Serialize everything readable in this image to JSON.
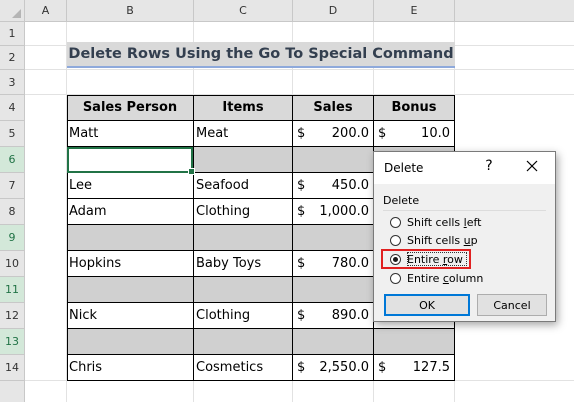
{
  "columns": [
    "A",
    "B",
    "C",
    "D",
    "E"
  ],
  "rows": [
    "1",
    "2",
    "3",
    "4",
    "5",
    "6",
    "7",
    "8",
    "9",
    "10",
    "11",
    "12",
    "13",
    "14"
  ],
  "title": "Delete Rows Using the Go To Special Command",
  "table": {
    "headers": [
      "Sales Person",
      "Items",
      "Sales",
      "Bonus"
    ],
    "rows": [
      {
        "person": "Matt",
        "item": "Meat",
        "sales": "200.0",
        "bonus": "10.0"
      },
      {
        "person": "",
        "item": "",
        "sales": "",
        "bonus": ""
      },
      {
        "person": "Lee",
        "item": "Seafood",
        "sales": "450.0",
        "bonus": ""
      },
      {
        "person": "Adam",
        "item": "Clothing",
        "sales": "1,000.0",
        "bonus": ""
      },
      {
        "person": "",
        "item": "",
        "sales": "",
        "bonus": ""
      },
      {
        "person": "Hopkins",
        "item": "Baby Toys",
        "sales": "780.0",
        "bonus": ""
      },
      {
        "person": "",
        "item": "",
        "sales": "",
        "bonus": ""
      },
      {
        "person": "Nick",
        "item": "Clothing",
        "sales": "890.0",
        "bonus": ""
      },
      {
        "person": "",
        "item": "",
        "sales": "",
        "bonus": ""
      },
      {
        "person": "Chris",
        "item": "Cosmetics",
        "sales": "2,550.0",
        "bonus": "127.5"
      }
    ],
    "currency": "$"
  },
  "dialog": {
    "title": "Delete",
    "help": "?",
    "group_label": "Delete",
    "options": [
      {
        "label_pre": "Shift cells ",
        "label_key": "l",
        "label_post": "eft",
        "selected": false
      },
      {
        "label_pre": "Shift cells ",
        "label_key": "u",
        "label_post": "p",
        "selected": false
      },
      {
        "label_pre": "Entire ",
        "label_key": "r",
        "label_post": "ow",
        "selected": true
      },
      {
        "label_pre": "Entire ",
        "label_key": "c",
        "label_post": "olumn",
        "selected": false
      }
    ],
    "ok": "OK",
    "cancel": "Cancel"
  },
  "colors": {
    "accent_green": "#217346",
    "highlight_red": "#e02020",
    "blank_row_gray": "#d0d0d0",
    "header_gray": "#d9d9d9"
  },
  "icons": [
    "close-icon",
    "help-icon",
    "select-all-icon"
  ]
}
